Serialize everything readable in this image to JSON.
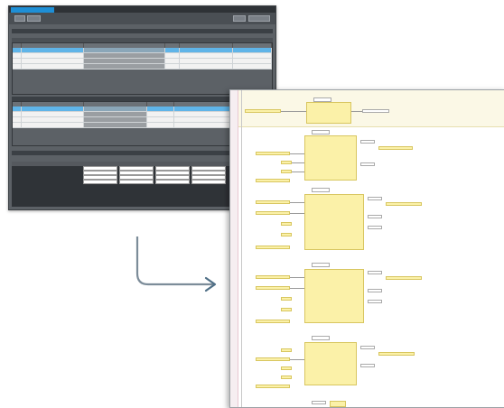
{
  "left_window": {
    "tab_label": "",
    "toolbar": {
      "btn_left_1": "",
      "btn_left_2": "",
      "btn_right_1": "",
      "btn_right_2": ""
    },
    "section1_label": "",
    "section2_label": "",
    "section3_label": "",
    "colors": {
      "selected_row": "#5fb4e8",
      "window_bg": "#5c6166"
    }
  },
  "right_window": {
    "colors": {
      "block_fill": "#fbf1a8",
      "block_border": "#d8c660",
      "gutter": "#f6eef1"
    }
  },
  "icons": {
    "connector_arrow": "arrow-right-icon"
  }
}
